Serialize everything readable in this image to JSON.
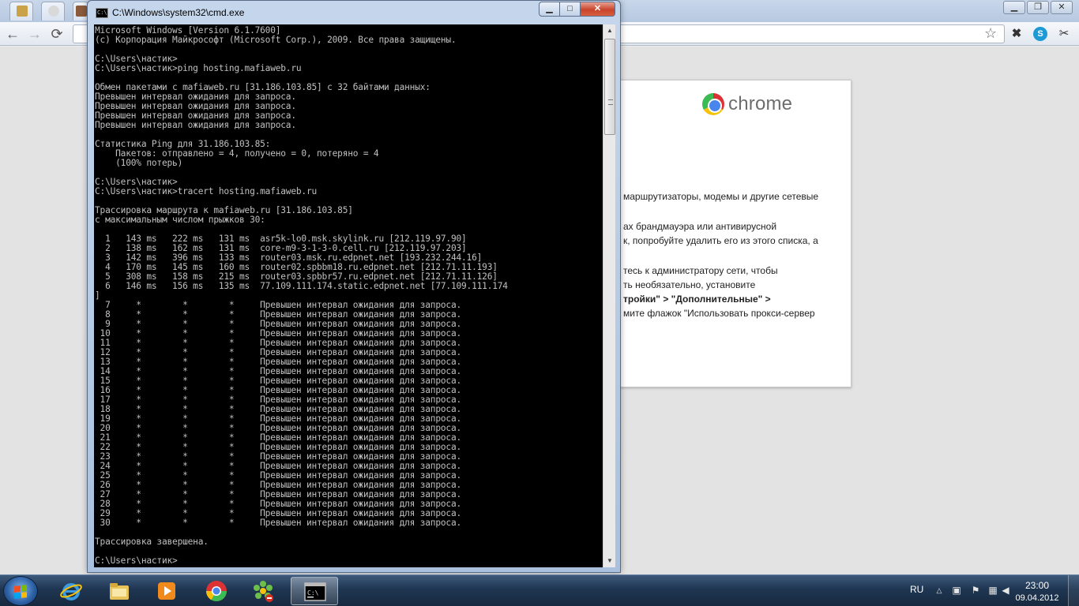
{
  "cmd_window": {
    "title": "C:\\Windows\\system32\\cmd.exe",
    "icon_label": "C:\\",
    "console_lines": [
      "Microsoft Windows [Version 6.1.7600]",
      "(c) Корпорация Майкрософт (Microsoft Corp.), 2009. Все права защищены.",
      "",
      "C:\\Users\\настик>",
      "C:\\Users\\настик>ping hosting.mafiaweb.ru",
      "",
      "Обмен пакетами с mafiaweb.ru [31.186.103.85] с 32 байтами данных:",
      "Превышен интервал ожидания для запроса.",
      "Превышен интервал ожидания для запроса.",
      "Превышен интервал ожидания для запроса.",
      "Превышен интервал ожидания для запроса.",
      "",
      "Статистика Ping для 31.186.103.85:",
      "    Пакетов: отправлено = 4, получено = 0, потеряно = 4",
      "    (100% потерь)",
      "",
      "C:\\Users\\настик>",
      "C:\\Users\\настик>tracert hosting.mafiaweb.ru",
      "",
      "Трассировка маршрута к mafiaweb.ru [31.186.103.85]",
      "с максимальным числом прыжков 30:",
      "",
      "  1   143 ms   222 ms   131 ms  asr5k-lo0.msk.skylink.ru [212.119.97.90]",
      "  2   138 ms   162 ms   131 ms  core-m9-3-1-3-0.cell.ru [212.119.97.203]",
      "  3   142 ms   396 ms   133 ms  router03.msk.ru.edpnet.net [193.232.244.16]",
      "  4   170 ms   145 ms   160 ms  router02.spbbm18.ru.edpnet.net [212.71.11.193]",
      "  5   308 ms   158 ms   215 ms  router03.spbbr57.ru.edpnet.net [212.71.11.126]",
      "  6   146 ms   156 ms   135 ms  77.109.111.174.static.edpnet.net [77.109.111.174",
      "]",
      "  7     *        *        *     Превышен интервал ожидания для запроса.",
      "  8     *        *        *     Превышен интервал ожидания для запроса.",
      "  9     *        *        *     Превышен интервал ожидания для запроса.",
      " 10     *        *        *     Превышен интервал ожидания для запроса.",
      " 11     *        *        *     Превышен интервал ожидания для запроса.",
      " 12     *        *        *     Превышен интервал ожидания для запроса.",
      " 13     *        *        *     Превышен интервал ожидания для запроса.",
      " 14     *        *        *     Превышен интервал ожидания для запроса.",
      " 15     *        *        *     Превышен интервал ожидания для запроса.",
      " 16     *        *        *     Превышен интервал ожидания для запроса.",
      " 17     *        *        *     Превышен интервал ожидания для запроса.",
      " 18     *        *        *     Превышен интервал ожидания для запроса.",
      " 19     *        *        *     Превышен интервал ожидания для запроса.",
      " 20     *        *        *     Превышен интервал ожидания для запроса.",
      " 21     *        *        *     Превышен интервал ожидания для запроса.",
      " 22     *        *        *     Превышен интервал ожидания для запроса.",
      " 23     *        *        *     Превышен интервал ожидания для запроса.",
      " 24     *        *        *     Превышен интервал ожидания для запроса.",
      " 25     *        *        *     Превышен интервал ожидания для запроса.",
      " 26     *        *        *     Превышен интервал ожидания для запроса.",
      " 27     *        *        *     Превышен интервал ожидания для запроса.",
      " 28     *        *        *     Превышен интервал ожидания для запроса.",
      " 29     *        *        *     Превышен интервал ожидания для запроса.",
      " 30     *        *        *     Превышен интервал ожидания для запроса.",
      "",
      "Трассировка завершена.",
      "",
      "C:\\Users\\настик>"
    ],
    "buttons": {
      "minimize": "▁",
      "maximize": "□",
      "close": "✕"
    }
  },
  "chrome": {
    "window_buttons": {
      "minimize": "▁",
      "maximize": "❐",
      "close": "✕"
    },
    "nav": {
      "back": "←",
      "forward": "→",
      "reload": "⟳"
    },
    "star": "☆",
    "extensions": [
      "✖",
      "S",
      "✂"
    ],
    "logo_text": "chrome",
    "error_lines": [
      {
        "text": "маршрутизаторы, модемы и другие сетевые"
      },
      {
        "text": "ах брандмауэра или антивирусной"
      },
      {
        "text": "к, попробуйте удалить его из этого списка, а"
      },
      {
        "text": "тесь к администратору сети, чтобы"
      },
      {
        "text": "ть необязательно, установите"
      },
      {
        "text": "тройки\" > \"Дополнительные\" >",
        "bold": true
      },
      {
        "text": "мите флажок \"Использовать прокси-сервер"
      }
    ]
  },
  "taskbar": {
    "language": "RU",
    "time": "23:00",
    "date": "09.04.2012",
    "apps": [
      {
        "name": "internet-explorer"
      },
      {
        "name": "windows-explorer"
      },
      {
        "name": "media-player"
      },
      {
        "name": "google-chrome"
      },
      {
        "name": "icq"
      },
      {
        "name": "command-prompt",
        "active": true
      }
    ]
  },
  "colors": {
    "console_bg": "#000000",
    "console_text": "#c0c0c0",
    "close_button": "#c8442a",
    "taskbar": "#1f3652"
  }
}
